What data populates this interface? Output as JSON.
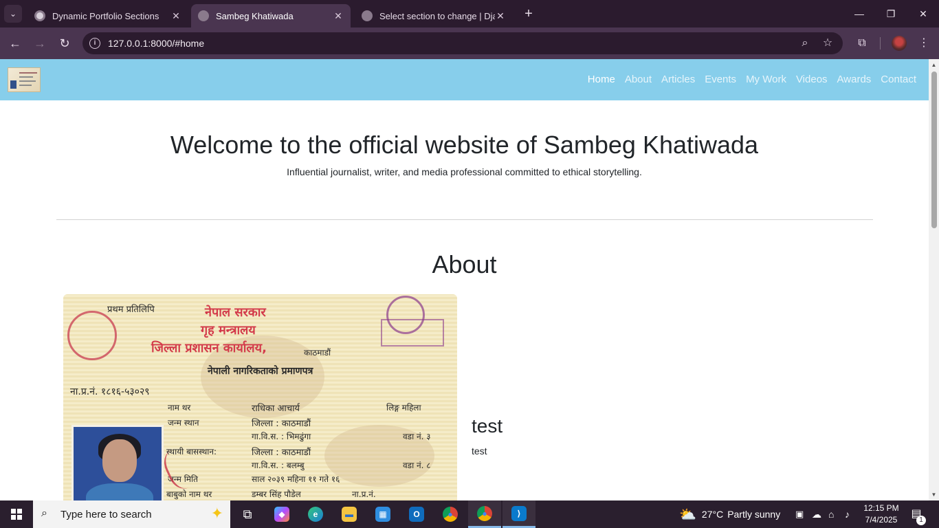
{
  "browser": {
    "tabs": [
      {
        "title": "Dynamic Portfolio Sections",
        "active": false
      },
      {
        "title": "Sambeg Khatiwada",
        "active": true
      },
      {
        "title": "Select section to change | Django",
        "active": false
      }
    ],
    "url": "127.0.0.1:8000/#home",
    "icons": {
      "tab_search": "chevron-down-icon",
      "new_tab": "plus-icon",
      "back": "back-arrow-icon",
      "forward": "forward-arrow-icon",
      "reload": "reload-icon",
      "site_info": "info-icon",
      "zoom": "zoom-icon",
      "bookmark": "star-icon",
      "extensions": "puzzle-icon",
      "menu": "kebab-menu-icon"
    },
    "glyphs": {
      "chevron": "⌄",
      "close": "✕",
      "plus": "+",
      "minimize": "—",
      "restore": "❐",
      "back": "←",
      "forward": "→",
      "reload": "↻",
      "info": "i",
      "zoom": "⌕",
      "star": "☆",
      "puzzle": "⧉",
      "menu": "⋮"
    }
  },
  "site": {
    "nav": [
      {
        "label": "Home",
        "active": true
      },
      {
        "label": "About",
        "active": false
      },
      {
        "label": "Articles",
        "active": false
      },
      {
        "label": "Events",
        "active": false
      },
      {
        "label": "My Work",
        "active": false
      },
      {
        "label": "Videos",
        "active": false
      },
      {
        "label": "Awards",
        "active": false
      },
      {
        "label": "Contact",
        "active": false
      }
    ],
    "hero_title": "Welcome to the official website of Sambeg Khatiwada",
    "hero_subtitle": "Influential journalist, writer, and media professional committed to ethical storytelling.",
    "about_title": "About",
    "about_item": {
      "title": "test",
      "body": "test"
    },
    "document_text": {
      "copy": "प्रथम प्रतिलिपि",
      "gov": "नेपाल सरकार",
      "ministry": "गृह मन्त्रालय",
      "office": "जिल्ला प्रशासन कार्यालय,",
      "place": "काठमाडौं",
      "cert": "नेपाली नागरिकताको प्रमाणपत्र",
      "number": "ना.प्र.नं. १८१६-५३०२९",
      "name_label": "नाम थर",
      "name_value": "राधिका आचार्य",
      "gender": "लिङ्ग महिला",
      "birth_label": "जन्म स्थान",
      "birth_value": "जिल्ला : काठमाडौं",
      "vdc1": "गा.वि.स. : भिमढुंगा",
      "ward1": "वडा नं. ३",
      "perm_label": "स्थायी बासस्थान:",
      "perm_value": "जिल्ला : काठमाडौं",
      "vdc2": "गा.वि.स. : बलम्बु",
      "ward2": "वडा नं. ८",
      "dob_label": "जन्म मिति",
      "dob_value": "साल २०३९ महिना ११ गते १६",
      "father_label": "बाबुको नाम थर",
      "father_value": "डम्बर सिंह पौडेल",
      "father_no": "ना.प्र.नं."
    }
  },
  "taskbar": {
    "search_placeholder": "Type here to search",
    "weather_temp": "27°C",
    "weather_desc": "Partly sunny",
    "time": "12:15 PM",
    "date": "7/4/2025",
    "notifications": "1",
    "icons": {
      "start": "windows-logo-icon",
      "search": "search-icon",
      "task_view": "task-view-icon",
      "weather": "weather-partly-sunny-icon",
      "notification": "notification-icon"
    },
    "glyphs": {
      "search": "⌕",
      "task_view": "⧉",
      "spark": "✦",
      "meet": "▣",
      "cloud": "☁",
      "network": "⌂",
      "volume": "♪",
      "notification": "▤",
      "weather": "⛅"
    },
    "apps": [
      {
        "name": "copilot",
        "glyph": "◆"
      },
      {
        "name": "edge",
        "glyph": "e"
      },
      {
        "name": "file-explorer",
        "glyph": "▬"
      },
      {
        "name": "store",
        "glyph": "▦"
      },
      {
        "name": "outlook",
        "glyph": "O"
      },
      {
        "name": "chrome",
        "glyph": "●"
      },
      {
        "name": "chrome-profile",
        "glyph": "●"
      },
      {
        "name": "vscode",
        "glyph": "⟩"
      }
    ]
  }
}
